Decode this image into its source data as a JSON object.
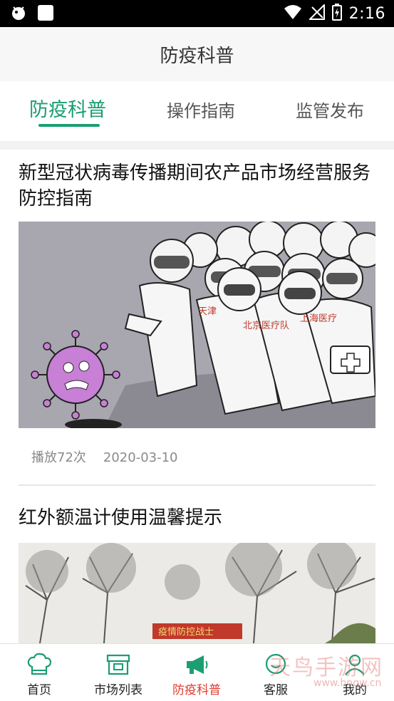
{
  "status_bar": {
    "time": "2:16"
  },
  "header": {
    "title": "防疫科普"
  },
  "tabs": [
    {
      "label": "防疫科普",
      "active": true
    },
    {
      "label": "操作指南",
      "active": false
    },
    {
      "label": "监管发布",
      "active": false
    }
  ],
  "articles": [
    {
      "title": "新型冠状病毒传播期间农产品市场经营服务防控指南",
      "plays": "播放72次",
      "date": "2020-03-10",
      "image_text": [
        "北京医疗队",
        "上海医疗",
        "天津"
      ]
    },
    {
      "title": "红外额温计使用温馨提示",
      "image_text": [
        "疫情防控战士"
      ]
    }
  ],
  "bottom_nav": [
    {
      "label": "首页",
      "icon": "chef-hat-icon",
      "active": false
    },
    {
      "label": "市场列表",
      "icon": "market-icon",
      "active": false
    },
    {
      "label": "防疫科普",
      "icon": "megaphone-icon",
      "active": true
    },
    {
      "label": "客服",
      "icon": "customer-service-icon",
      "active": false
    },
    {
      "label": "我的",
      "icon": "user-icon",
      "active": false
    }
  ],
  "watermark": {
    "text": "天鸟手游网",
    "url": "www.hnqw.cn"
  },
  "colors": {
    "accent": "#1a9e72",
    "nav_active": "#e23a2e"
  }
}
